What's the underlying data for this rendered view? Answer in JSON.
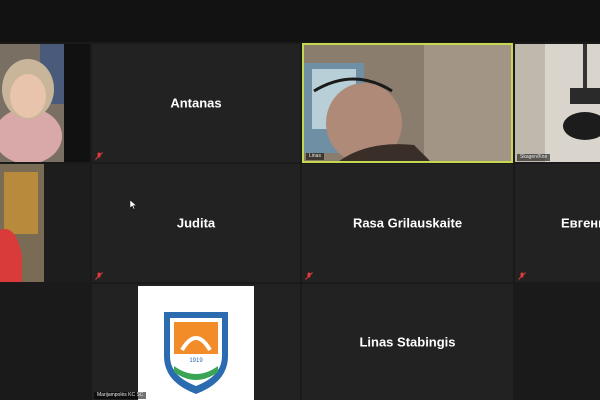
{
  "window": {
    "title": ""
  },
  "participants": [
    {
      "id": "p1",
      "name": "",
      "muted": false,
      "video": true
    },
    {
      "id": "p2",
      "name": "Antanas",
      "muted": true,
      "video": false
    },
    {
      "id": "p3",
      "name": "Linas",
      "muted": false,
      "video": true,
      "active_speaker": true
    },
    {
      "id": "p4",
      "name": "Skagen/Kne",
      "muted": false,
      "video": true
    },
    {
      "id": "p5",
      "name": "",
      "muted": false,
      "video": true
    },
    {
      "id": "p6",
      "name": "Judita",
      "muted": true,
      "video": false
    },
    {
      "id": "p7",
      "name": "Rasa Grilauskaite",
      "muted": true,
      "video": false
    },
    {
      "id": "p8",
      "name": "Евгени",
      "muted": true,
      "video": false
    },
    {
      "id": "p9",
      "name": "Marijampolės KC SC",
      "muted": false,
      "video": true
    },
    {
      "id": "p10",
      "name": "Linas Stabingis",
      "muted": false,
      "video": false
    }
  ],
  "logo": {
    "year": "1919"
  },
  "colors": {
    "tile_bg": "#222222",
    "speaker_border": "#c6d94e",
    "mute_icon": "#e03b3b"
  }
}
